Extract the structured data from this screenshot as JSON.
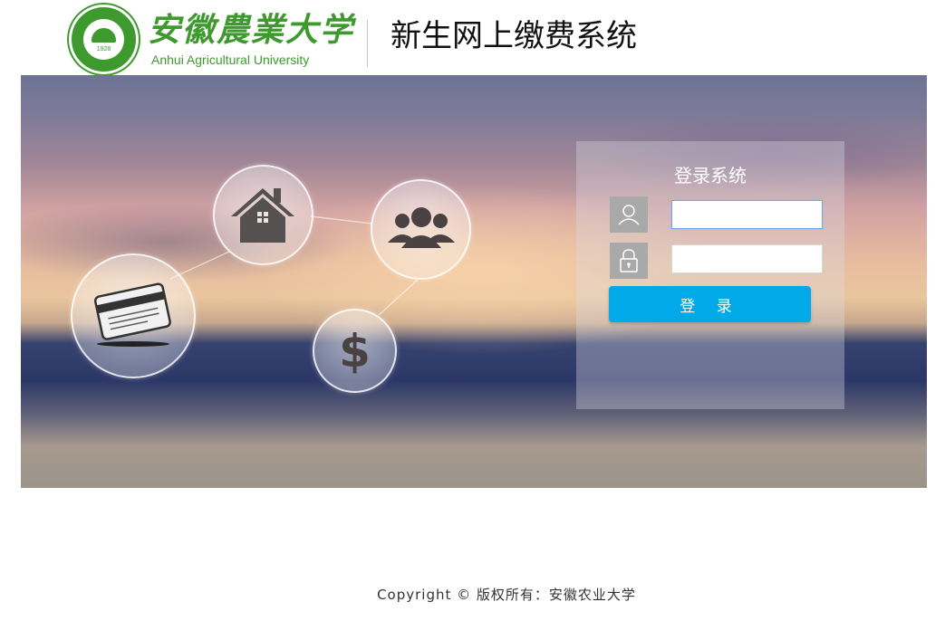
{
  "header": {
    "logo_year": "1928",
    "university_name_cn": "安徽農業大学",
    "university_name_en": "Anhui Agricultural University",
    "system_title": "新生网上缴费系统"
  },
  "banner": {
    "icons": [
      "bank-card-icon",
      "house-icon",
      "group-icon",
      "dollar-icon"
    ]
  },
  "login": {
    "title": "登录系统",
    "username_value": "",
    "password_value": "",
    "user_icon": "user-icon",
    "lock_icon": "lock-icon",
    "button_label": "登 录",
    "button_color": "#00aae8"
  },
  "footer": {
    "copyright": "Copyright © 版权所有：安徽农业大学"
  },
  "colors": {
    "brand_green": "#3e9a2e"
  }
}
